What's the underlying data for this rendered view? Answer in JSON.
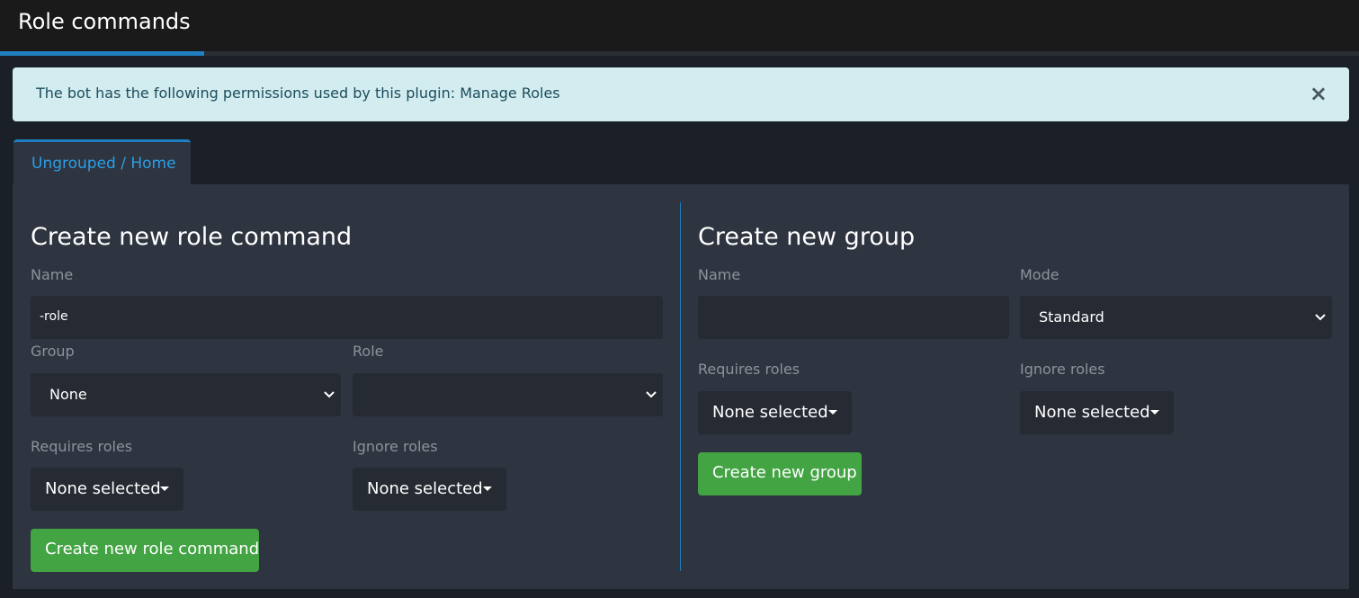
{
  "header": {
    "title": "Role commands"
  },
  "alert": {
    "text": "The bot has the following permissions used by this plugin: Manage Roles",
    "close_symbol": "×"
  },
  "tabs": [
    {
      "label": "Ungrouped / Home",
      "active": true
    }
  ],
  "role_command_form": {
    "title": "Create new role command",
    "name_label": "Name",
    "name_value": "-role",
    "group_label": "Group",
    "group_value": "None",
    "role_label": "Role",
    "role_value": "",
    "requires_roles_label": "Requires roles",
    "requires_roles_value": "None selected",
    "ignore_roles_label": "Ignore roles",
    "ignore_roles_value": "None selected",
    "submit_label": "Create new role command"
  },
  "group_form": {
    "title": "Create new group",
    "name_label": "Name",
    "name_value": "",
    "mode_label": "Mode",
    "mode_value": "Standard",
    "requires_roles_label": "Requires roles",
    "requires_roles_value": "None selected",
    "ignore_roles_label": "Ignore roles",
    "ignore_roles_value": "None selected",
    "submit_label": "Create new group"
  },
  "colors": {
    "accent": "#1f7fc1",
    "success": "#43a443",
    "alert_bg": "#d2ecf0",
    "panel_bg": "#2e3440"
  }
}
